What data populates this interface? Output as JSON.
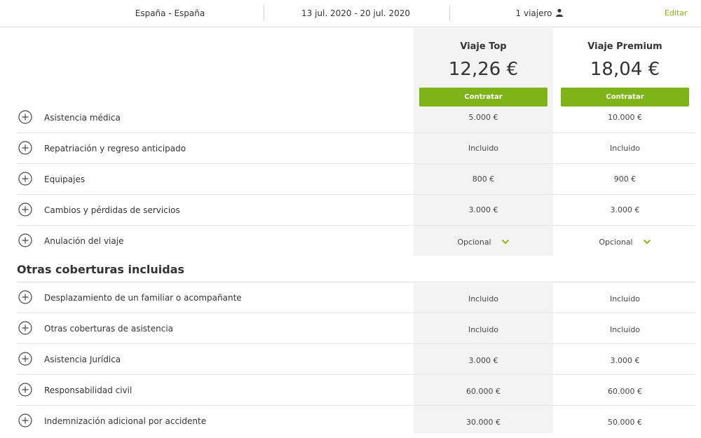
{
  "header": {
    "route": "España - España",
    "dates": "13 jul. 2020 - 20 jul. 2020",
    "travelers": "1 viajero",
    "edit": "Editar"
  },
  "plans": [
    {
      "name": "Viaje Top",
      "price": "12,26 €",
      "button": "Contratar"
    },
    {
      "name": "Viaje Premium",
      "price": "18,04 €",
      "button": "Contratar"
    }
  ],
  "coverages": [
    {
      "label": "Asistencia médica",
      "top": "5.000 €",
      "premium": "10.000 €"
    },
    {
      "label": "Repatriación y regreso anticipado",
      "top": "Incluido",
      "premium": "Incluido"
    },
    {
      "label": "Equipajes",
      "top": "800 €",
      "premium": "900 €"
    },
    {
      "label": "Cambios y pérdidas de servicios",
      "top": "3.000 €",
      "premium": "3.000 €"
    },
    {
      "label": "Anulación del viaje",
      "top": "Opcional",
      "premium": "Opcional"
    }
  ],
  "other_section": {
    "title": "Otras coberturas incluidas",
    "items": [
      {
        "label": "Desplazamiento de un familiar o acompañante",
        "top": "Incluido",
        "premium": "Incluido"
      },
      {
        "label": "Otras coberturas de asistencia",
        "top": "Incluido",
        "premium": "Incluido"
      },
      {
        "label": "Asistencia Jurídica",
        "top": "3.000 €",
        "premium": "3.000 €"
      },
      {
        "label": "Responsabilidad civil",
        "top": "60.000 €",
        "premium": "60.000 €"
      },
      {
        "label": "Indemnización adicional por accidente",
        "top": "30.000 €",
        "premium": "50.000 €"
      }
    ]
  },
  "colors": {
    "accent": "#7fb419",
    "edit": "#8cb61c",
    "shade": "#f3f3f3"
  },
  "icons": {
    "expand": "plus-circle-icon",
    "dropdown": "chevron-down-icon",
    "user": "user-icon"
  }
}
